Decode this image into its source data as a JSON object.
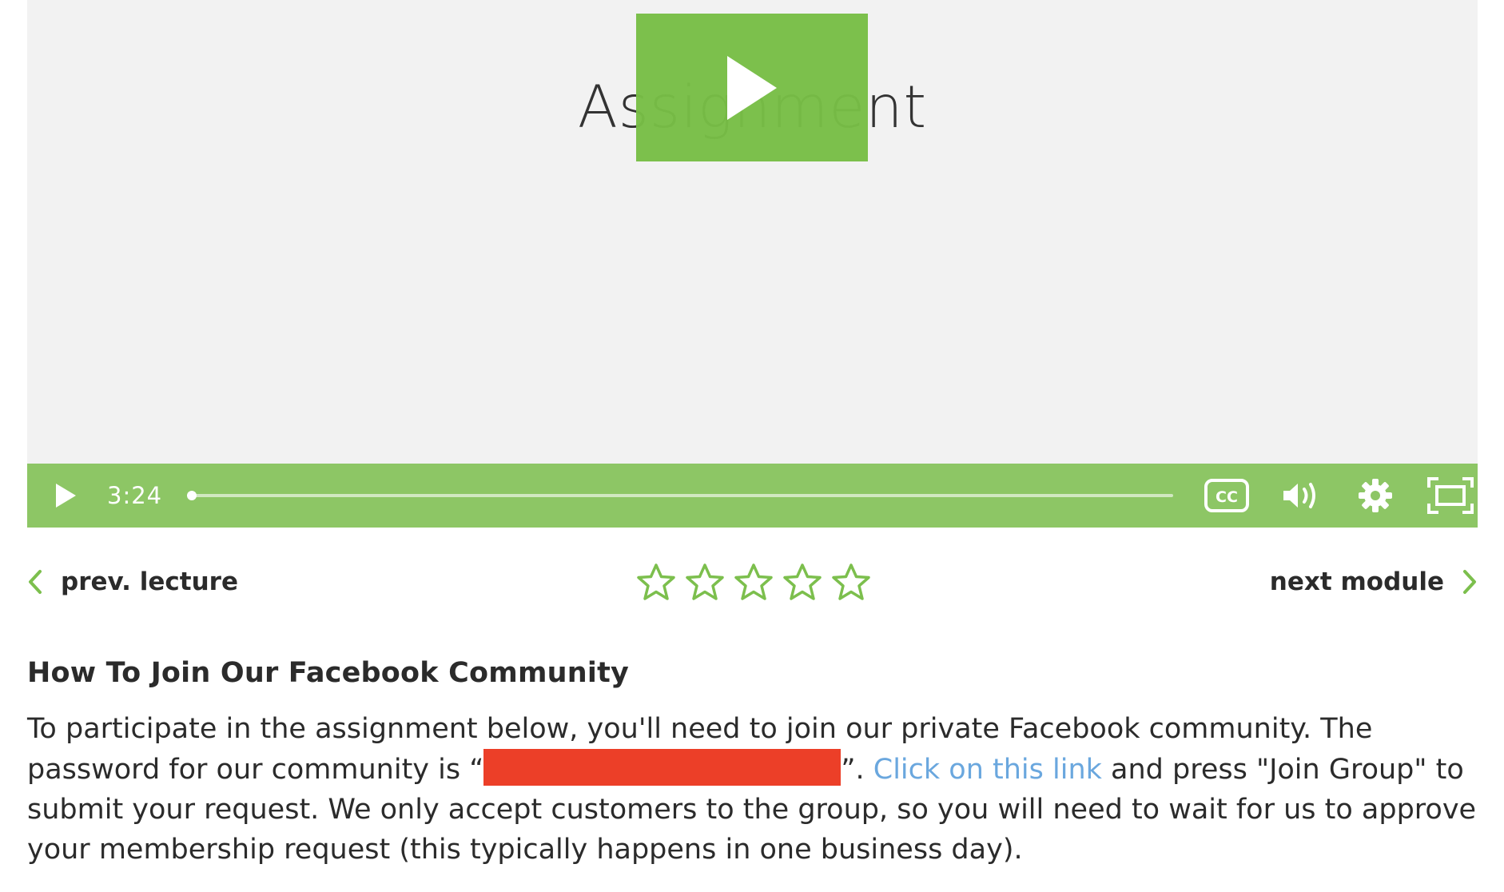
{
  "video": {
    "title": "Assignment",
    "current_time": "3:24",
    "progress": 0,
    "accent_color": "#7cbf4d",
    "controls": {
      "play_icon": "play-icon",
      "cc_icon": "closed-captions-icon",
      "volume_icon": "volume-icon",
      "settings_icon": "gear-icon",
      "fullscreen_icon": "fullscreen-icon"
    }
  },
  "nav": {
    "prev_label": "prev. lecture",
    "next_label": "next module",
    "rating": {
      "max": 5,
      "value": 0
    }
  },
  "content": {
    "heading": "How To Join Our Facebook Community",
    "para_part1": "To participate in the assignment below, you'll need to join our private Facebook community. The password for our community is “",
    "para_part2": "”. ",
    "link_text": "Click on this link",
    "para_part3": " and press \"Join Group\" to submit your request. We only accept customers to the group, so you will need to wait for us to approve your membership request (this typically happens in one business day).",
    "redaction_color": "#ec3f28",
    "link_color": "#6aa7de"
  }
}
